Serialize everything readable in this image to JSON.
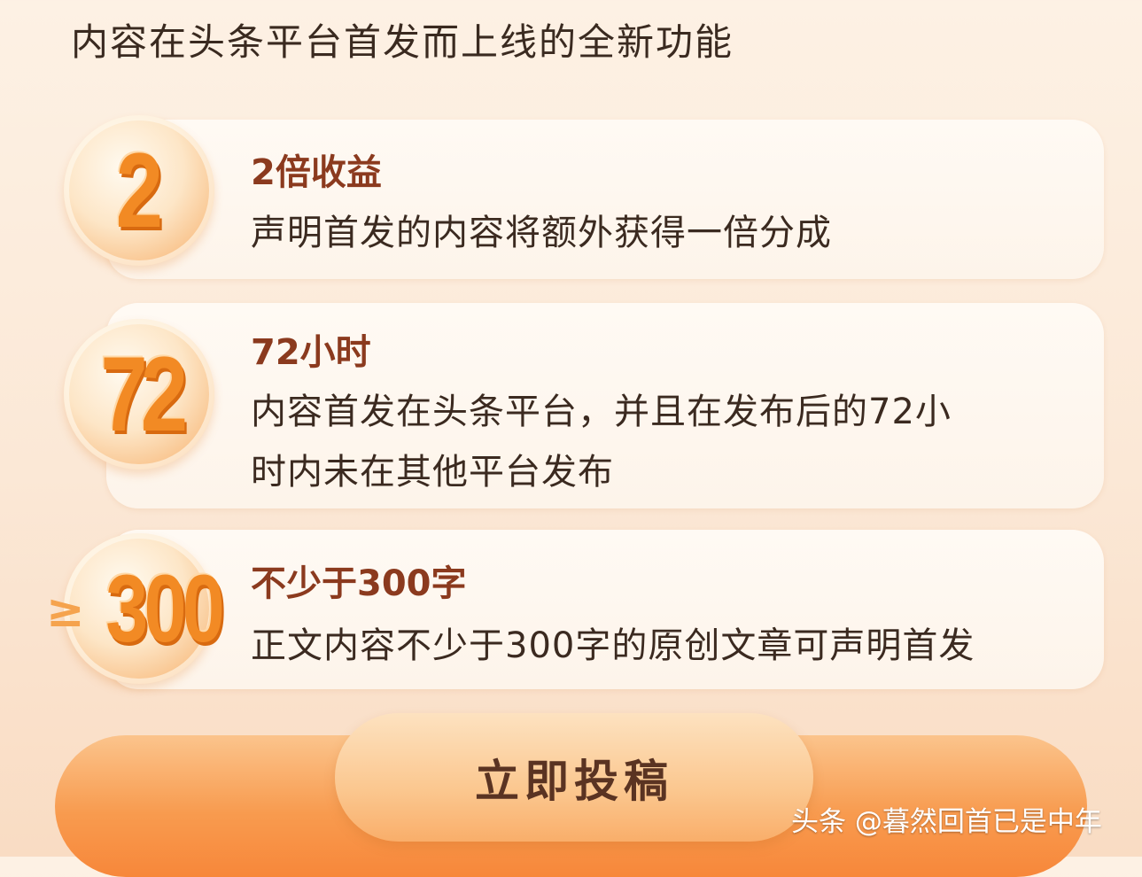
{
  "intro": "内容在头条平台首发而上线的全新功能",
  "features": [
    {
      "badge": "2",
      "title": "2倍收益",
      "desc": [
        "声明首发的内容将额外获得一倍分成"
      ]
    },
    {
      "badge": "72",
      "title": "72小时",
      "desc": [
        "内容首发在头条平台，并且在发布后的72小",
        "时内未在其他平台发布"
      ]
    },
    {
      "badge_prefix": "≥",
      "badge": "300",
      "title": "不少于300字",
      "desc": [
        "正文内容不少于300字的原创文章可声明首发"
      ]
    }
  ],
  "cta": {
    "label": "立即投稿"
  },
  "watermark": "头条 @暮然回首已是中年",
  "colors": {
    "accent": "#f28a24",
    "title": "#8b3a1e",
    "text": "#3b2a20"
  }
}
